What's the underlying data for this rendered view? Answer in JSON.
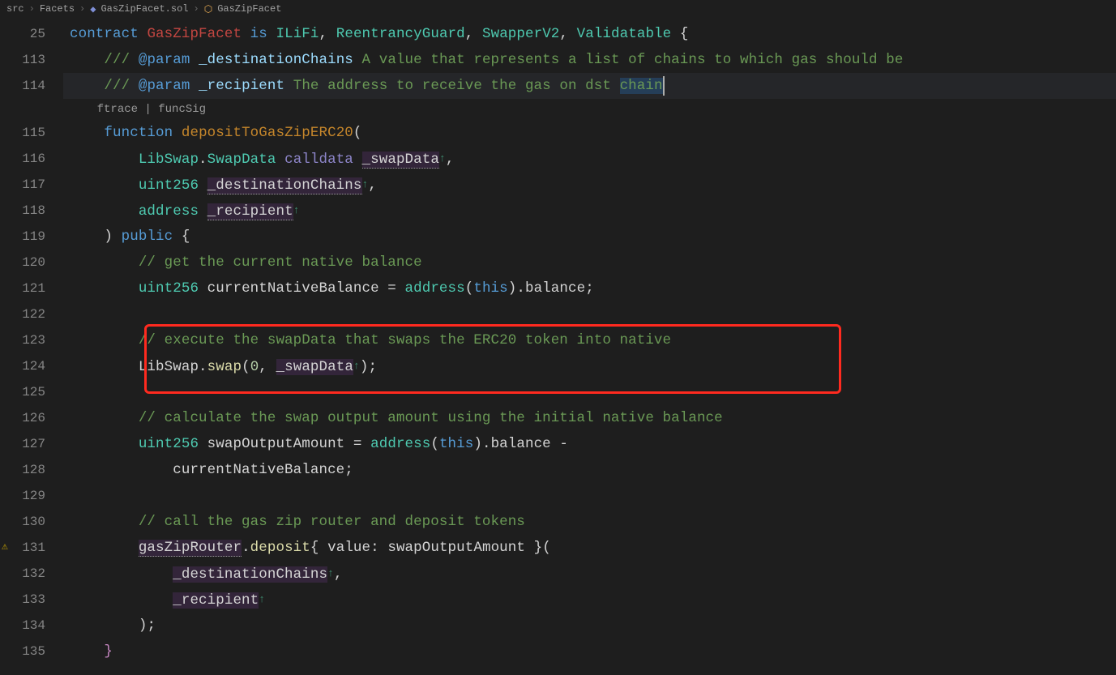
{
  "breadcrumb": {
    "seg1": "src",
    "seg2": "Facets",
    "seg3": "GasZipFacet.sol",
    "seg4": "GasZipFacet"
  },
  "codelens": {
    "ftrace": "ftrace",
    "funcSig": "funcSig"
  },
  "lines": {
    "l25": "25",
    "l113": "113",
    "l114": "114",
    "l115": "115",
    "l116": "116",
    "l117": "117",
    "l118": "118",
    "l119": "119",
    "l120": "120",
    "l121": "121",
    "l122": "122",
    "l123": "123",
    "l124": "124",
    "l125": "125",
    "l126": "126",
    "l127": "127",
    "l128": "128",
    "l129": "129",
    "l130": "130",
    "l131": "131",
    "l132": "132",
    "l133": "133",
    "l134": "134",
    "l135": "135"
  },
  "t": {
    "contract": "contract",
    "GasZipFacet": "GasZipFacet",
    "is": "is",
    "ILiFi": "ILiFi",
    "ReentrancyGuard": "ReentrancyGuard",
    "SwapperV2": "SwapperV2",
    "Validatable": "Validatable",
    "brace_open": "{",
    "brace_close": "}",
    "comma": ",",
    "paren_open": "(",
    "paren_close": ")",
    "semicolon": ";",
    "docslash": "/// ",
    "atparam": "@param",
    "p_dest_name": "_destinationChains",
    "p_dest_doc": " A value that represents a list of chains to which gas should be ",
    "p_recip_name": "_recipient",
    "p_recip_doc": " The address to receive the gas on dst ",
    "chain": "chain",
    "function": "function",
    "depositToGasZipERC20": "depositToGasZipERC20",
    "LibSwap": "LibSwap",
    "SwapData": "SwapData",
    "calldata": "calldata",
    "_swapData": "_swapData",
    "uint256": "uint256",
    "_destinationChains": "_destinationChains",
    "address": "address",
    "_recipient": "_recipient",
    "public": "public",
    "c_native": "// get the current native balance",
    "currentNativeBalance": "currentNativeBalance",
    "eq": " = ",
    "this": "this",
    "dot_balance": ".balance",
    "c_execute": "// execute the swapData that swaps the ERC20 token into native",
    "swap": "swap",
    "zero": "0",
    "c_calc": "// calculate the swap output amount using the initial native balance",
    "swapOutputAmount": "swapOutputAmount",
    "minus": " -",
    "c_call": "// call the gas zip router and deposit tokens",
    "gasZipRouter": "gasZipRouter",
    "deposit": "deposit",
    "value": "value",
    "colon": ":",
    "space": " "
  }
}
